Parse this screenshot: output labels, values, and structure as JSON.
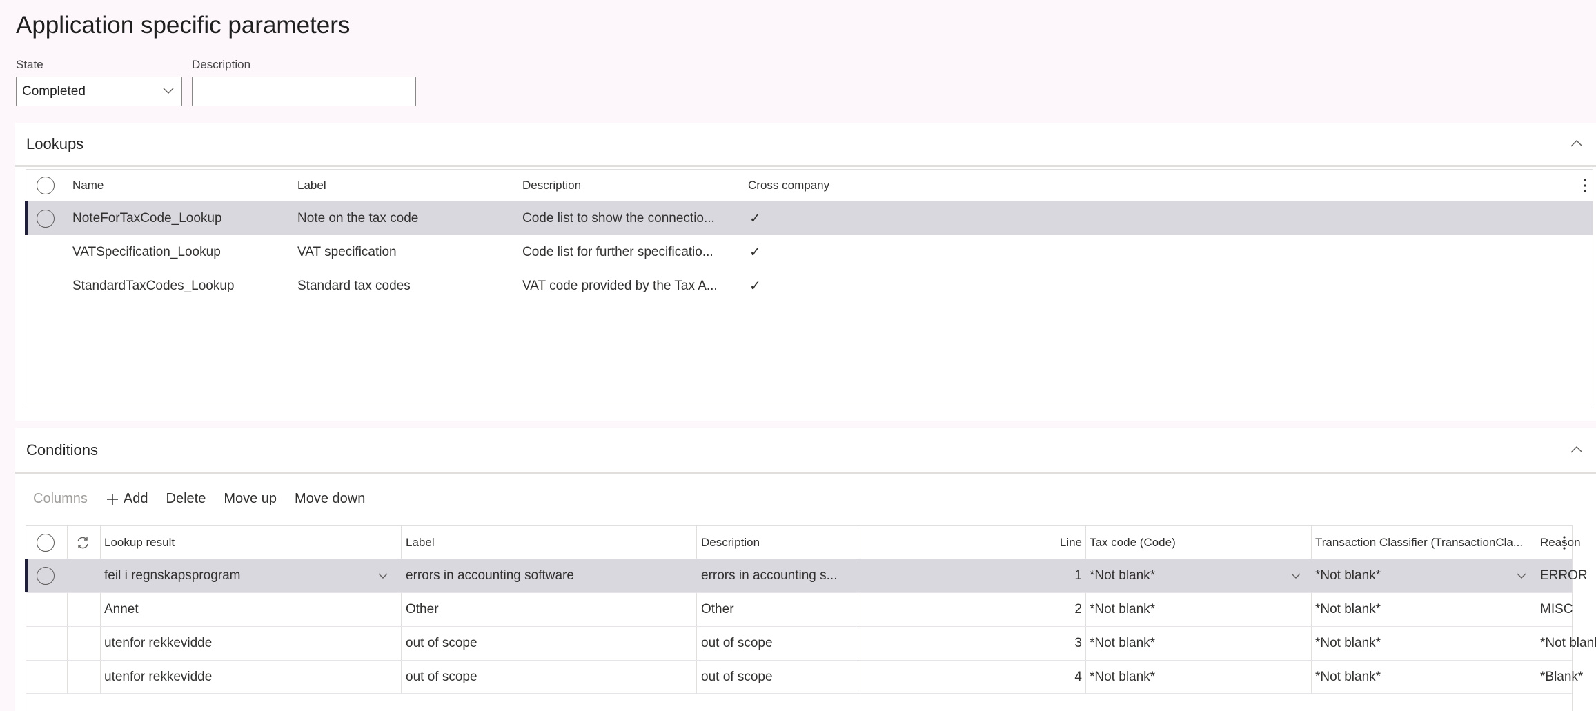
{
  "page": {
    "breadcrumb": "",
    "title": "Application specific parameters"
  },
  "form": {
    "state_label": "State",
    "state_value": "Completed",
    "description_label": "Description",
    "description_value": ""
  },
  "lookups": {
    "title": "Lookups",
    "columns": [
      "Name",
      "Label",
      "Description",
      "Cross company"
    ],
    "rows": [
      {
        "name": "NoteForTaxCode_Lookup",
        "label": "Note on the tax code",
        "description": "Code list to show the connectio...",
        "cross_company": true,
        "selected": true
      },
      {
        "name": "VATSpecification_Lookup",
        "label": "VAT specification",
        "description": "Code list for further specificatio...",
        "cross_company": true,
        "selected": false
      },
      {
        "name": "StandardTaxCodes_Lookup",
        "label": "Standard tax codes",
        "description": "VAT code provided by the Tax A...",
        "cross_company": true,
        "selected": false
      }
    ],
    "check_glyph": "✓"
  },
  "conditions": {
    "title": "Conditions",
    "toolbar": {
      "columns": "Columns",
      "add": "Add",
      "delete": "Delete",
      "move_up": "Move up",
      "move_down": "Move down"
    },
    "columns": [
      "Lookup result",
      "Label",
      "Description",
      "Line",
      "Tax code (Code)",
      "Transaction Classifier (TransactionCla...",
      "Reason"
    ],
    "rows": [
      {
        "lookup_result": "feil i regnskapsprogram",
        "label": "errors in accounting software",
        "description": "errors in accounting s...",
        "line": "1",
        "tax_code": "*Not blank*",
        "transaction_classifier": "*Not blank*",
        "reason": "ERROR",
        "selected": true
      },
      {
        "lookup_result": "Annet",
        "label": "Other",
        "description": "Other",
        "line": "2",
        "tax_code": "*Not blank*",
        "transaction_classifier": "*Not blank*",
        "reason": "MISC",
        "selected": false
      },
      {
        "lookup_result": "utenfor rekkevidde",
        "label": "out of scope",
        "description": "out of scope",
        "line": "3",
        "tax_code": "*Not blank*",
        "transaction_classifier": "*Not blank*",
        "reason": "*Not blank*",
        "selected": false
      },
      {
        "lookup_result": "utenfor rekkevidde",
        "label": "out of scope",
        "description": "out of scope",
        "line": "4",
        "tax_code": "*Not blank*",
        "transaction_classifier": "*Not blank*",
        "reason": "*Blank*",
        "selected": false
      }
    ]
  },
  "colors": {
    "page_bg": "#fdf6fb",
    "selected_row": "#dad8df",
    "selected_accent": "#201f3a"
  }
}
